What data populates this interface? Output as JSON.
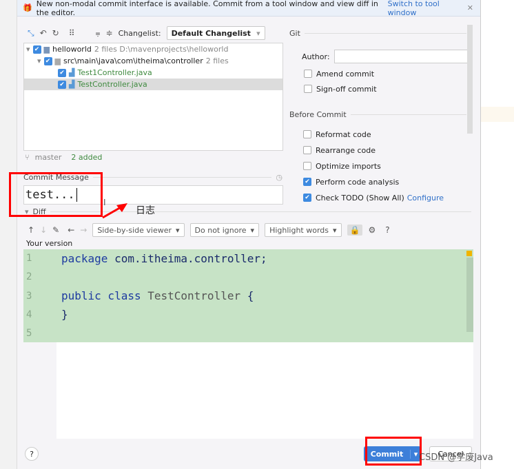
{
  "banner": {
    "text": "New non-modal commit interface is available. Commit from a tool window and view diff in the editor.",
    "link": "Switch to tool window"
  },
  "toolbar": {
    "changelist_label": "Changelist:",
    "changelist_value": "Default Changelist"
  },
  "tree": [
    {
      "name": "helloworld",
      "meta": "2 files  D:\\mavenprojects\\helloworld"
    },
    {
      "name": "src\\main\\java\\com\\itheima\\controller",
      "meta": "2 files"
    },
    {
      "name": "Test1Controller.java"
    },
    {
      "name": "TestController.java"
    }
  ],
  "status": {
    "branch": "master",
    "added": "2 added"
  },
  "commit_message": {
    "label": "Commit Message",
    "value": "test..."
  },
  "diff": {
    "label": "Diff",
    "viewer": "Side-by-side viewer",
    "ignore": "Do not ignore",
    "highlight": "Highlight words",
    "help": "?",
    "your_version": "Your version",
    "lines": [
      {
        "n": "1",
        "text": "package com.itheima.controller;"
      },
      {
        "n": "2",
        "text": ""
      },
      {
        "n": "3",
        "text": "public class TestController {"
      },
      {
        "n": "4",
        "text": "}"
      },
      {
        "n": "5",
        "text": ""
      }
    ]
  },
  "git": {
    "title": "Git",
    "author_label": "Author:",
    "author_value": "",
    "amend": "Amend commit",
    "signoff": "Sign-off commit"
  },
  "before_commit": {
    "title": "Before Commit",
    "options": [
      {
        "label": "Reformat code",
        "checked": false
      },
      {
        "label": "Rearrange code",
        "checked": false
      },
      {
        "label": "Optimize imports",
        "checked": false
      },
      {
        "label": "Perform code analysis",
        "checked": true
      },
      {
        "label": "Check TODO (Show All)",
        "checked": true,
        "link": "Configure"
      }
    ]
  },
  "buttons": {
    "help": "?",
    "commit": "Commit",
    "cancel": "Cancel"
  },
  "annotation": {
    "text": "日志",
    "color": "#ff0000"
  },
  "watermark": "CSDN @学废Java"
}
